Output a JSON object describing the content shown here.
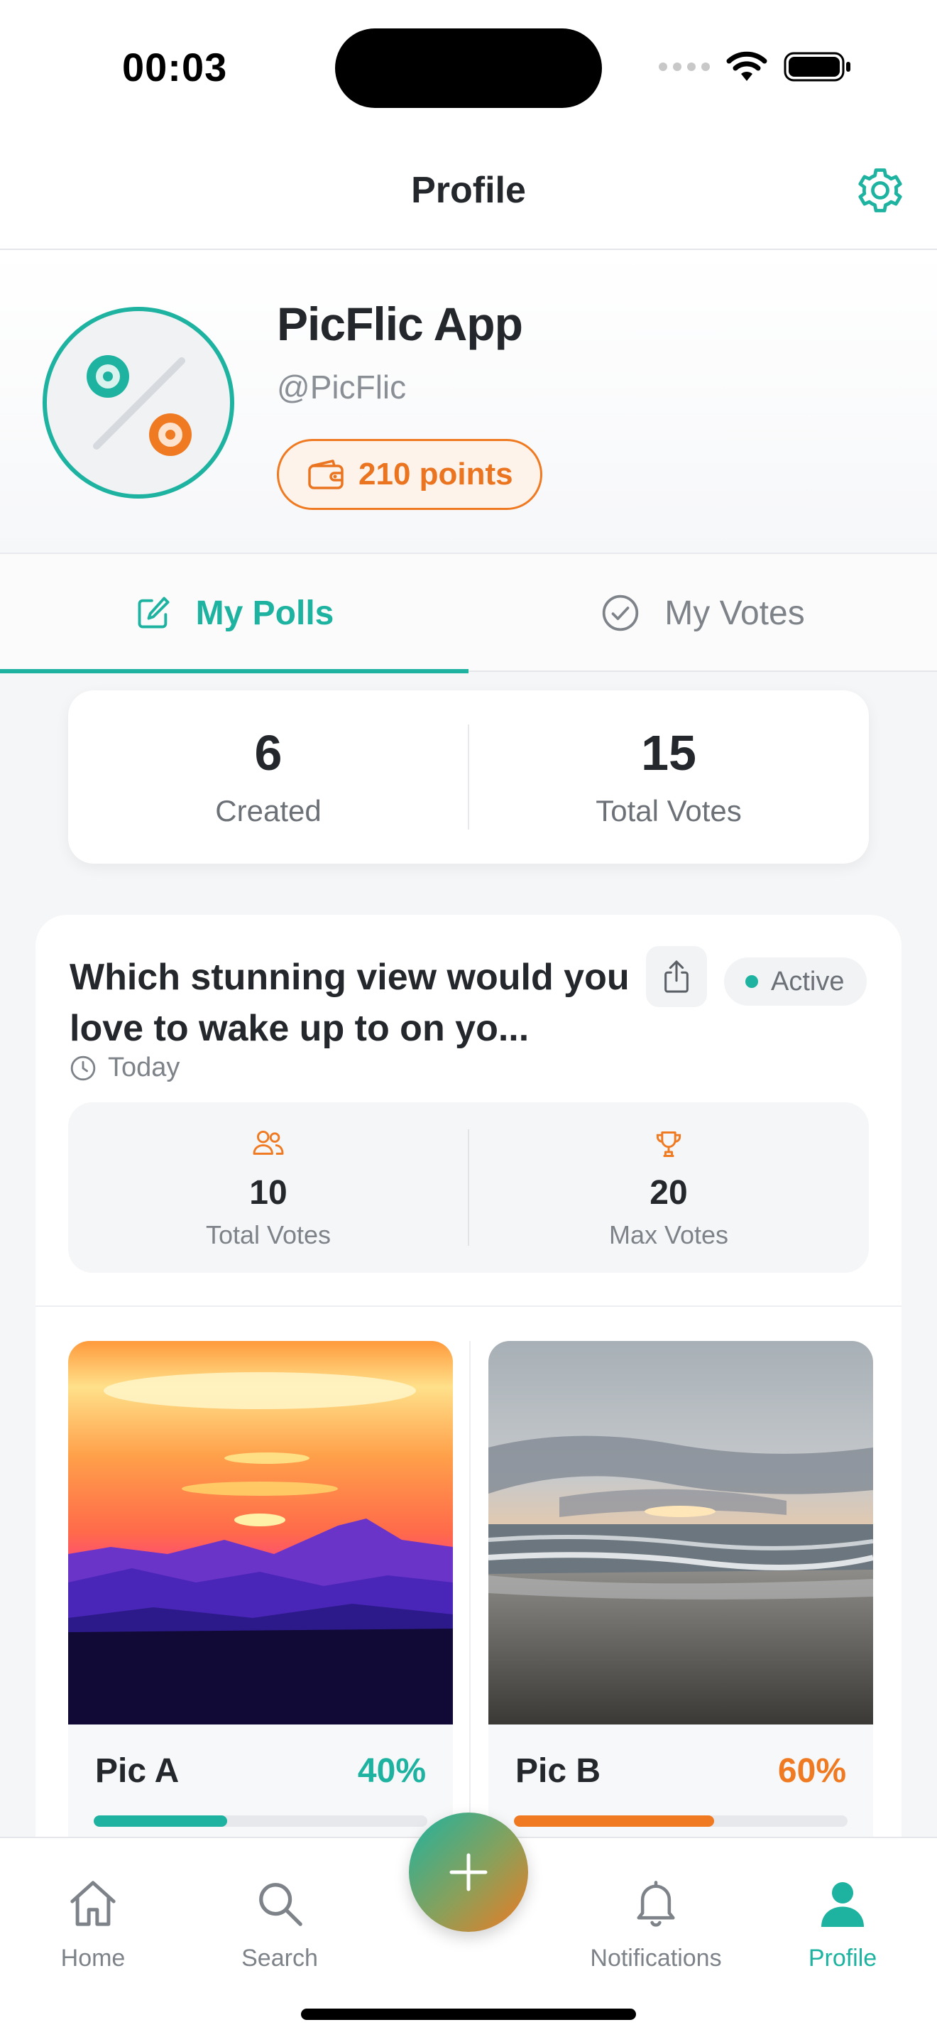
{
  "status_bar": {
    "time": "00:03"
  },
  "navbar": {
    "title": "Profile",
    "settings_icon": "gear-icon"
  },
  "profile": {
    "name": "PicFlic App",
    "handle": "@PicFlic",
    "points": "210 points"
  },
  "tabs": [
    {
      "label": "My Polls",
      "icon": "edit-icon",
      "selected": true
    },
    {
      "label": "My Votes",
      "icon": "check-circle-icon",
      "selected": false
    }
  ],
  "stats": {
    "created_value": "6",
    "created_label": "Created",
    "votes_value": "15",
    "votes_label": "Total Votes"
  },
  "poll": {
    "title": "Which stunning view would you love to wake up to on yo...",
    "status": "Active",
    "date": "Today",
    "total_votes_value": "10",
    "total_votes_label": "Total Votes",
    "max_votes_value": "20",
    "max_votes_label": "Max Votes",
    "options": [
      {
        "name": "Pic A",
        "percent_label": "40%",
        "percent": 40,
        "image": "mountain sunset"
      },
      {
        "name": "Pic B",
        "percent_label": "60%",
        "percent": 60,
        "image": "beach sunset"
      }
    ]
  },
  "tabbar": {
    "home": "Home",
    "search": "Search",
    "notifications": "Notifications",
    "profile": "Profile",
    "active": "profile"
  },
  "colors": {
    "accent": "#1eb3a0",
    "secondary": "#ef7a22"
  }
}
